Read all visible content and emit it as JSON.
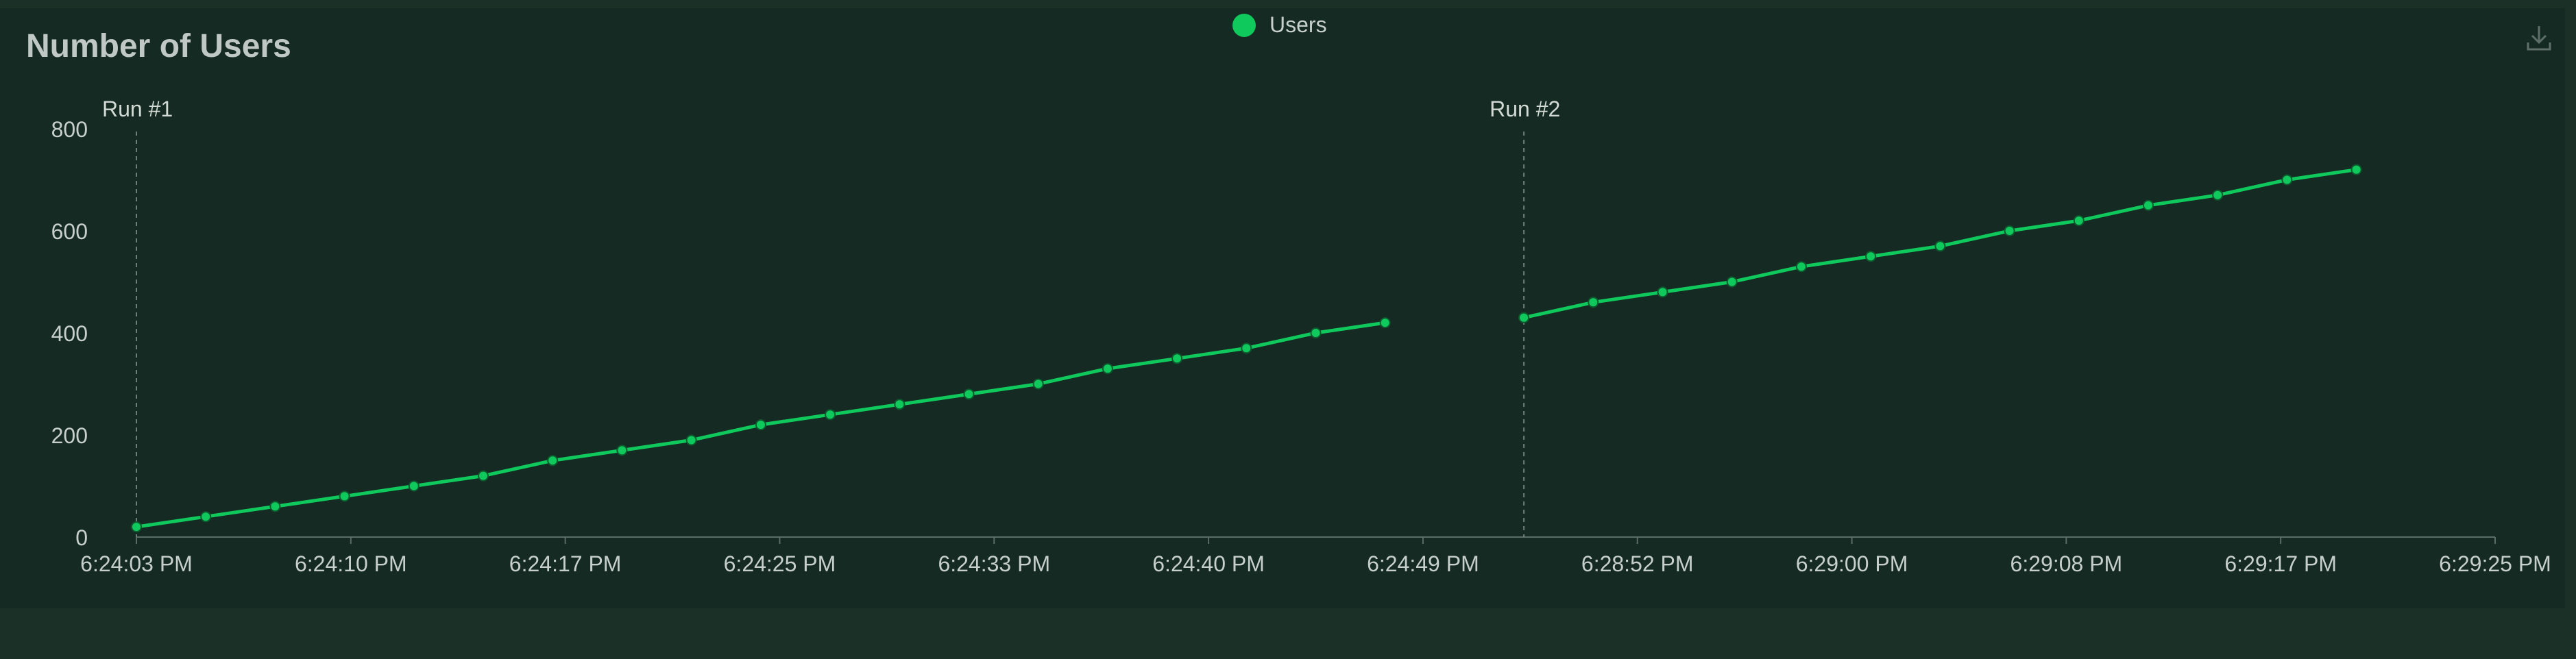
{
  "colors": {
    "series": "#10c95c",
    "axis_text": "#c6cfcb",
    "title_text": "#bfc8c4",
    "panel_bg": "#142a22",
    "page_bg": "#1b3128"
  },
  "toolbar": {
    "download_icon": "download-icon"
  },
  "chart_data": {
    "type": "line",
    "title": "Number of Users",
    "xlabel": "",
    "ylabel": "",
    "legend": {
      "placement": "top-center",
      "entries": [
        "Users"
      ]
    },
    "grid": false,
    "ylim": [
      0,
      800
    ],
    "yticks": [
      "0",
      "200",
      "400",
      "600",
      "800"
    ],
    "xticks": [
      "6:24:03 PM",
      "6:24:10 PM",
      "6:24:17 PM",
      "6:24:25 PM",
      "6:24:33 PM",
      "6:24:40 PM",
      "6:24:49 PM",
      "6:28:52 PM",
      "6:29:00 PM",
      "6:29:08 PM",
      "6:29:17 PM",
      "6:29:25 PM"
    ],
    "annotations": [
      {
        "label": "Run #1",
        "run": 0
      },
      {
        "label": "Run #2",
        "run": 1
      }
    ],
    "series": [
      {
        "name": "Users",
        "runs": [
          [
            20,
            40,
            60,
            80,
            100,
            120,
            150,
            170,
            190,
            220,
            240,
            260,
            280,
            300,
            330,
            350,
            370,
            400,
            420
          ],
          [
            430,
            460,
            480,
            500,
            530,
            550,
            570,
            600,
            620,
            650,
            670,
            700,
            720
          ]
        ]
      }
    ]
  }
}
